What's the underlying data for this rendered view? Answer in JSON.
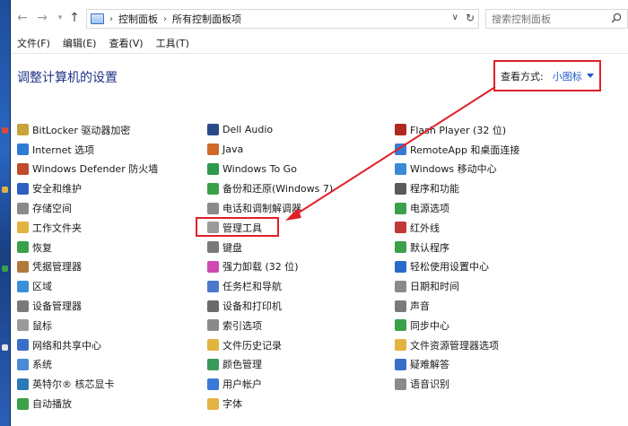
{
  "address": {
    "breadcrumb": [
      "控制面板",
      "所有控制面板项"
    ],
    "search_placeholder": "搜索控制面板"
  },
  "menu": [
    "文件(F)",
    "编辑(E)",
    "查看(V)",
    "工具(T)"
  ],
  "header": {
    "title": "调整计算机的设置",
    "view_label": "查看方式:",
    "view_value": "小图标"
  },
  "columns": [
    [
      {
        "label": "BitLocker 驱动器加密",
        "icon": "bitlocker-icon",
        "color": "#c8a23a"
      },
      {
        "label": "Internet 选项",
        "icon": "internet-icon",
        "color": "#2e7bd6"
      },
      {
        "label": "Windows Defender 防火墙",
        "icon": "firewall-icon",
        "color": "#c04a2a"
      },
      {
        "label": "安全和维护",
        "icon": "flag-icon",
        "color": "#2f5fbf"
      },
      {
        "label": "存储空间",
        "icon": "storage-icon",
        "color": "#8a8a8a"
      },
      {
        "label": "工作文件夹",
        "icon": "folder-icon",
        "color": "#e3b341"
      },
      {
        "label": "恢复",
        "icon": "recovery-icon",
        "color": "#3aa04a"
      },
      {
        "label": "凭据管理器",
        "icon": "credential-icon",
        "color": "#b07a3a"
      },
      {
        "label": "区域",
        "icon": "region-icon",
        "color": "#3a8fd6"
      },
      {
        "label": "设备管理器",
        "icon": "device-manager-icon",
        "color": "#7a7a7a"
      },
      {
        "label": "鼠标",
        "icon": "mouse-icon",
        "color": "#9a9a9a"
      },
      {
        "label": "网络和共享中心",
        "icon": "network-icon",
        "color": "#3a6fc8"
      },
      {
        "label": "系统",
        "icon": "system-icon",
        "color": "#4a8ad6"
      },
      {
        "label": "英特尔® 核芯显卡",
        "icon": "intel-graphics-icon",
        "color": "#2a7ab8"
      },
      {
        "label": "自动播放",
        "icon": "autoplay-icon",
        "color": "#3aa04a"
      }
    ],
    [
      {
        "label": "Dell Audio",
        "icon": "dell-audio-icon",
        "color": "#2a4a8a"
      },
      {
        "label": "Java",
        "icon": "java-icon",
        "color": "#d06a2a"
      },
      {
        "label": "Windows To Go",
        "icon": "windows-to-go-icon",
        "color": "#2e9a4a"
      },
      {
        "label": "备份和还原(Windows 7)",
        "icon": "backup-icon",
        "color": "#3aa04a"
      },
      {
        "label": "电话和调制解调器",
        "icon": "phone-icon",
        "color": "#8a8a8a"
      },
      {
        "label": "管理工具",
        "icon": "admin-tools-icon",
        "color": "#9a9a9a"
      },
      {
        "label": "键盘",
        "icon": "keyboard-icon",
        "color": "#7a7a7a"
      },
      {
        "label": "强力卸载 (32 位)",
        "icon": "uninstall-icon",
        "color": "#d04ab0"
      },
      {
        "label": "任务栏和导航",
        "icon": "taskbar-icon",
        "color": "#4a7ac8"
      },
      {
        "label": "设备和打印机",
        "icon": "printer-icon",
        "color": "#6a6a6a"
      },
      {
        "label": "索引选项",
        "icon": "index-icon",
        "color": "#8a8a8a"
      },
      {
        "label": "文件历史记录",
        "icon": "file-history-icon",
        "color": "#e3b341"
      },
      {
        "label": "颜色管理",
        "icon": "color-icon",
        "color": "#3a9a5a"
      },
      {
        "label": "用户帐户",
        "icon": "user-accounts-icon",
        "color": "#3a7ad6"
      },
      {
        "label": "字体",
        "icon": "font-icon",
        "color": "#e3b341"
      }
    ],
    [
      {
        "label": "Flash Player (32 位)",
        "icon": "flash-icon",
        "color": "#b0281e"
      },
      {
        "label": "RemoteApp 和桌面连接",
        "icon": "remoteapp-icon",
        "color": "#3a7ad6"
      },
      {
        "label": "Windows 移动中心",
        "icon": "mobility-icon",
        "color": "#3a8ad6"
      },
      {
        "label": "程序和功能",
        "icon": "programs-icon",
        "color": "#5a5a5a"
      },
      {
        "label": "电源选项",
        "icon": "power-icon",
        "color": "#3aa04a"
      },
      {
        "label": "红外线",
        "icon": "infrared-icon",
        "color": "#c03a3a"
      },
      {
        "label": "默认程序",
        "icon": "default-programs-icon",
        "color": "#3aa04a"
      },
      {
        "label": "轻松使用设置中心",
        "icon": "ease-access-icon",
        "color": "#2a6ac8"
      },
      {
        "label": "日期和时间",
        "icon": "clock-icon",
        "color": "#8a8a8a"
      },
      {
        "label": "声音",
        "icon": "sound-icon",
        "color": "#7a7a7a"
      },
      {
        "label": "同步中心",
        "icon": "sync-icon",
        "color": "#3aa04a"
      },
      {
        "label": "文件资源管理器选项",
        "icon": "explorer-options-icon",
        "color": "#e3b341"
      },
      {
        "label": "疑难解答",
        "icon": "troubleshoot-icon",
        "color": "#3a6fc8"
      },
      {
        "label": "语音识别",
        "icon": "microphone-icon",
        "color": "#8a8a8a"
      }
    ]
  ],
  "colors": {
    "title": "#1e3287",
    "link": "#1f5cc7",
    "annotation_red": "#e0202a"
  }
}
